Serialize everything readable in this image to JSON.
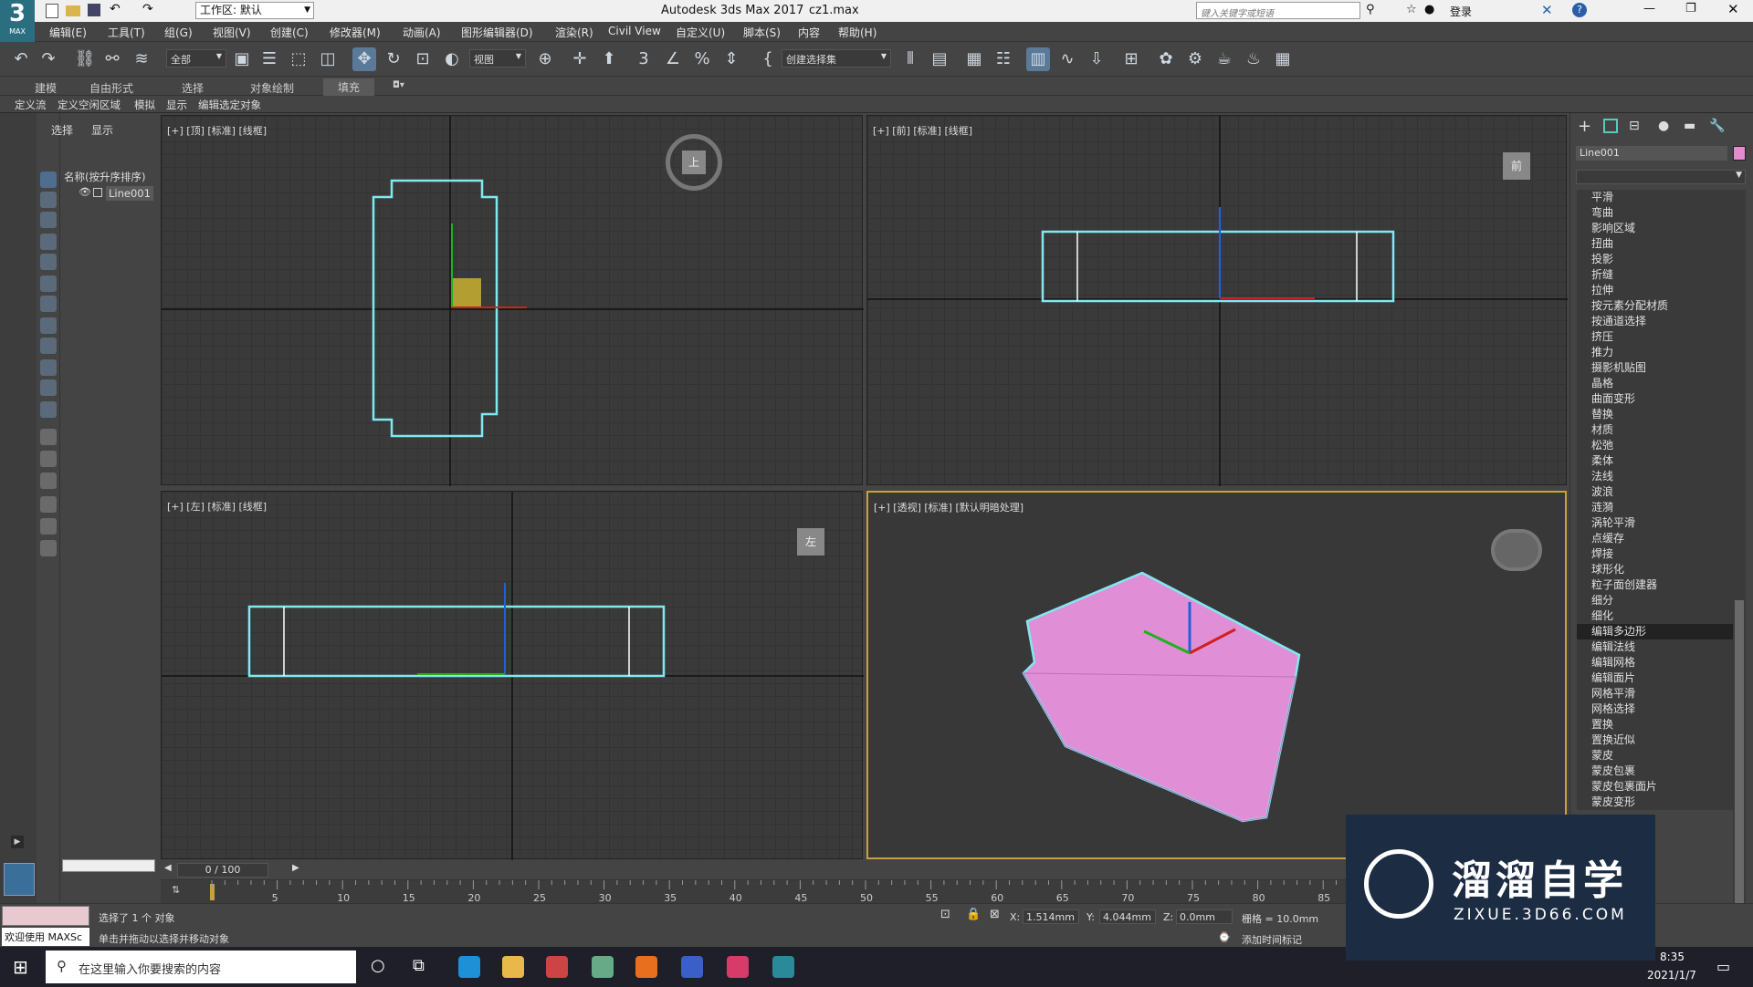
{
  "title_bar": {
    "app_title": "Autodesk 3ds Max 2017",
    "file_name": "cz1.max",
    "workspace_label": "工作区: 默认",
    "search_placeholder": "键入关键字或短语",
    "login_label": "登录"
  },
  "max_logo": {
    "label": "MAX"
  },
  "menu": [
    "编辑(E)",
    "工具(T)",
    "组(G)",
    "视图(V)",
    "创建(C)",
    "修改器(M)",
    "动画(A)",
    "图形编辑器(D)",
    "渲染(R)",
    "Civil View",
    "自定义(U)",
    "脚本(S)",
    "内容",
    "帮助(H)"
  ],
  "toolbar": {
    "filter_value": "全部",
    "ref_coord_value": "视图",
    "selection_set_value": "创建选择集"
  },
  "ribbon_tabs": [
    "建模",
    "自由形式",
    "选择",
    "对象绘制",
    "填充"
  ],
  "ribbon_subtabs": [
    "定义流",
    "定义空闲区域",
    "模拟",
    "显示",
    "编辑选定对象"
  ],
  "scene_explorer": {
    "tabs": [
      "选择",
      "显示"
    ],
    "column_header": "名称(按升序排序)",
    "items": [
      "Line001"
    ]
  },
  "viewports": {
    "top": "[+] [顶] [标准] [线框]",
    "front": "[+] [前] [标准] [线框]",
    "left": "[+] [左] [标准] [线框]",
    "perspective": "[+] [透视] [标准] [默认明暗处理]",
    "viewcube_top": "上",
    "viewcube_front": "前",
    "viewcube_left": "左"
  },
  "command_panel": {
    "object_name": "Line001",
    "object_color": "#e68ad0",
    "modifiers": [
      "平滑",
      "弯曲",
      "影响区域",
      "扭曲",
      "投影",
      "折缝",
      "拉伸",
      "按元素分配材质",
      "按通道选择",
      "挤压",
      "推力",
      "摄影机贴图",
      "晶格",
      "曲面变形",
      "替换",
      "材质",
      "松弛",
      "柔体",
      "法线",
      "波浪",
      "涟漪",
      "涡轮平滑",
      "点缓存",
      "焊接",
      "球形化",
      "粒子面创建器",
      "细分",
      "细化",
      "编辑多边形",
      "编辑法线",
      "编辑网格",
      "编辑面片",
      "网格平滑",
      "网格选择",
      "置换",
      "置换近似",
      "蒙皮",
      "蒙皮包裹",
      "蒙皮包裹面片",
      "蒙皮变形"
    ],
    "selected_modifier": "编辑多边形"
  },
  "timeline": {
    "frame_label": "0 / 100",
    "ticks": [
      "5",
      "10",
      "15",
      "20",
      "25",
      "30",
      "35",
      "40",
      "45",
      "50",
      "55",
      "60",
      "65",
      "70",
      "75",
      "80",
      "85"
    ]
  },
  "status": {
    "maxscript": "欢迎使用 MAXSc",
    "selected": "选择了 1 个 对象",
    "hint": "单击并拖动以选择并移动对象",
    "x_label": "X:",
    "x_value": "1.514mm",
    "y_label": "Y:",
    "y_value": "4.044mm",
    "z_label": "Z:",
    "z_value": "0.0mm",
    "grid": "栅格 = 10.0mm",
    "add_time_tag": "添加时间标记"
  },
  "taskbar": {
    "search_placeholder": "在这里输入你要搜索的内容",
    "time": "8:35",
    "date": "2021/1/7"
  },
  "watermark": {
    "brand": "溜溜自学",
    "url": "ZIXUE.3D66.COM"
  },
  "colors": {
    "shape_outline": "#7fe9f0",
    "object_fill": "#e08fd6",
    "viewport_bg": "#3a3a3a",
    "active_viewport_border": "#c8a040"
  }
}
